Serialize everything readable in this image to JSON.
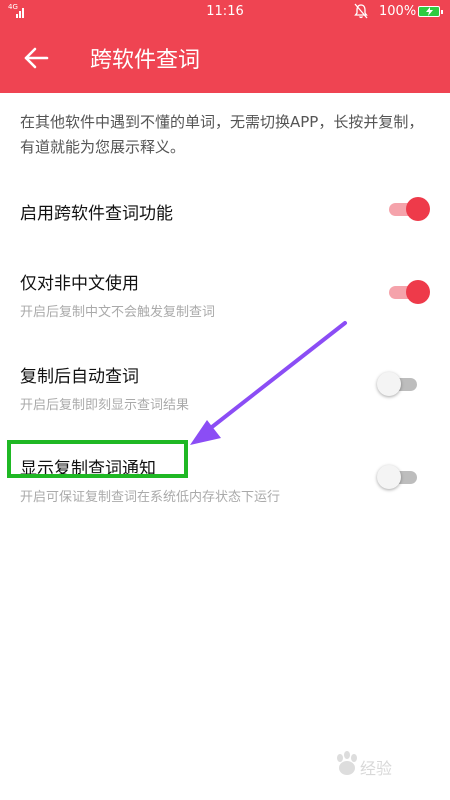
{
  "status_bar": {
    "network": "4G",
    "time": "11:16",
    "battery": "100%"
  },
  "appbar": {
    "title": "跨软件查词"
  },
  "description": "在其他软件中遇到不懂的单词，无需切换APP，长按并复制，有道就能为您展示释义。",
  "settings": [
    {
      "title": "启用跨软件查词功能",
      "subtitle": "",
      "enabled": true
    },
    {
      "title": "仅对非中文使用",
      "subtitle": "开启后复制中文不会触发复制查词",
      "enabled": true
    },
    {
      "title": "复制后自动查词",
      "subtitle": "开启后复制即刻显示查词结果",
      "enabled": false
    },
    {
      "title": "显示复制查词通知",
      "subtitle": "开启可保证复制查词在系统低内存状态下运行",
      "enabled": false
    }
  ],
  "colors": {
    "accent": "#ef4452",
    "toggle_on": "#ee3a4a",
    "highlight": "#1fb824",
    "arrow": "#8b4df5"
  },
  "watermark": "Baidu 经验"
}
